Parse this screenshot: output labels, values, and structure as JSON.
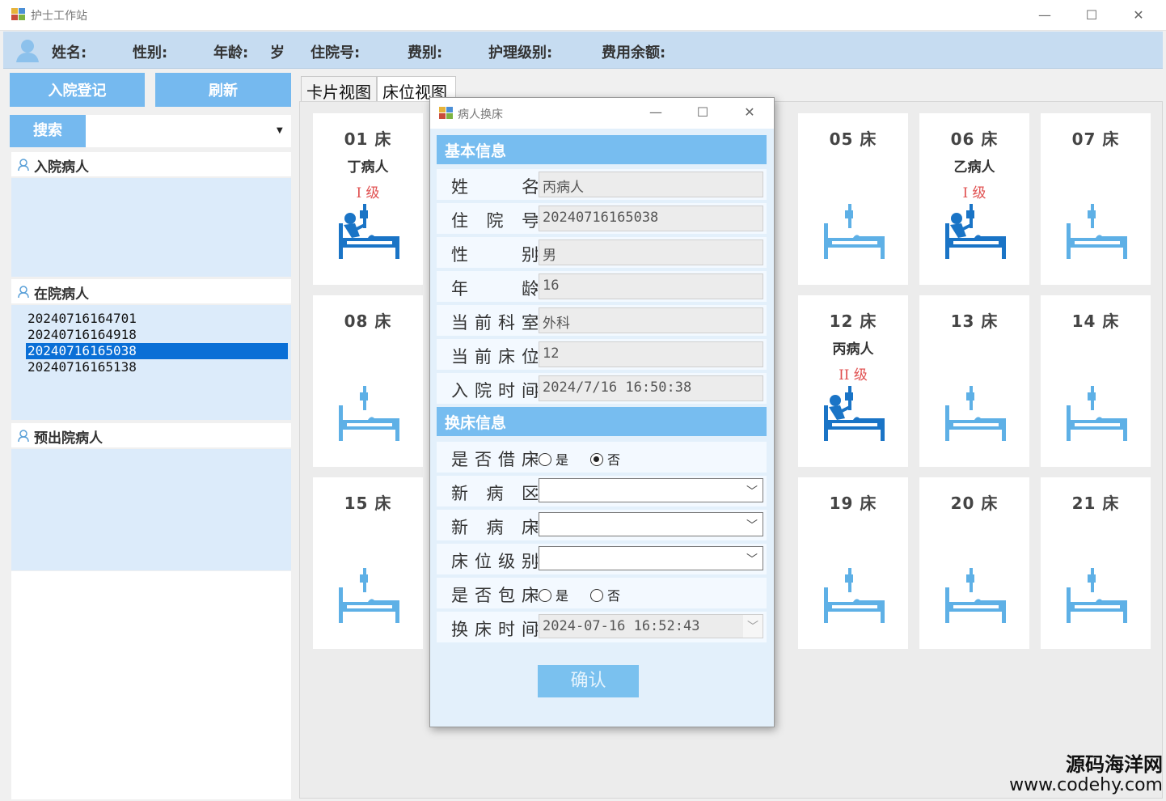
{
  "window": {
    "title": "护士工作站",
    "min": "—",
    "max": "☐",
    "close": "✕"
  },
  "info": {
    "name": "姓名:",
    "sex": "性别:",
    "age": "年龄:",
    "age_unit": "岁",
    "admission_no": "住院号:",
    "fee_type": "费别:",
    "care_level": "护理级别:",
    "balance": "费用余额:"
  },
  "left": {
    "admit_button": "入院登记",
    "refresh_button": "刷新",
    "search_button": "搜索",
    "groups": {
      "admitting": "入院病人",
      "in_hospital": "在院病人",
      "discharging": "预出院病人"
    },
    "in_hospital_patients": [
      "20240716164701",
      "20240716164918",
      "20240716165038",
      "20240716165138"
    ]
  },
  "tabs": [
    "卡片视图",
    "床位视图"
  ],
  "beds": [
    {
      "no": "01 床",
      "patient": "丁病人",
      "level": "I 级",
      "occupied": true
    },
    {
      "no": "05 床",
      "patient": "",
      "level": "",
      "occupied": false
    },
    {
      "no": "06 床",
      "patient": "乙病人",
      "level": "I 级",
      "occupied": true
    },
    {
      "no": "07 床",
      "patient": "",
      "level": "",
      "occupied": false
    },
    {
      "no": "08 床",
      "patient": "",
      "level": "",
      "occupied": false
    },
    {
      "no": "12 床",
      "patient": "丙病人",
      "level": "II 级",
      "occupied": true
    },
    {
      "no": "13 床",
      "patient": "",
      "level": "",
      "occupied": false
    },
    {
      "no": "14 床",
      "patient": "",
      "level": "",
      "occupied": false
    },
    {
      "no": "15 床",
      "patient": "",
      "level": "",
      "occupied": false
    },
    {
      "no": "19 床",
      "patient": "",
      "level": "",
      "occupied": false
    },
    {
      "no": "20 床",
      "patient": "",
      "level": "",
      "occupied": false
    },
    {
      "no": "21 床",
      "patient": "",
      "level": "",
      "occupied": false
    }
  ],
  "dialog": {
    "title": "病人换床",
    "basic_section": "基本信息",
    "fields": [
      {
        "label": "姓名",
        "value": "丙病人"
      },
      {
        "label": "住院号",
        "value": "20240716165038"
      },
      {
        "label": "性别",
        "value": "男"
      },
      {
        "label": "年龄",
        "value": "16"
      },
      {
        "label": "当前科室",
        "value": "外科"
      },
      {
        "label": "当前床位",
        "value": "12"
      },
      {
        "label": "入院时间",
        "value": "2024/7/16 16:50:38"
      }
    ],
    "change_section": "换床信息",
    "borrow_label": "是否借床",
    "new_ward_label": "新病区",
    "new_bed_label": "新病床",
    "bed_level_label": "床位级别",
    "private_label": "是否包床",
    "change_time_label": "换床时间",
    "change_time_value": "2024-07-16 16:52:43",
    "yes": "是",
    "no": "否",
    "borrow_selected": "否",
    "confirm_button": "确认"
  },
  "watermark": {
    "line1": "源码海洋网",
    "line2": "www.codehy.com"
  },
  "colors": {
    "accent": "#75b9ef",
    "header_bg": "#c6dcf1",
    "level_red": "#e05050",
    "bed_icon": "#4aa3df",
    "selected_row": "#0a6fd6"
  }
}
